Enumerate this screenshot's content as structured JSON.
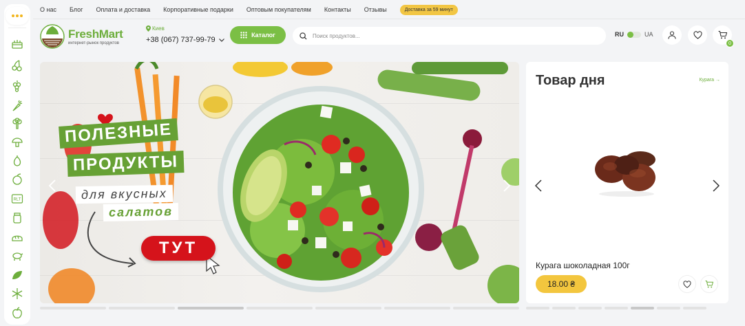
{
  "topnav": {
    "links": [
      "О нас",
      "Блог",
      "Оплата и доставка",
      "Корпоративные подарки",
      "Оптовым покупателям",
      "Контакты",
      "Отзывы"
    ],
    "delivery_badge": "Доставка за 59 минут"
  },
  "header": {
    "brand": "FreshMart",
    "brand_sub": "интернет-рынок продуктов",
    "city": "Киев",
    "phone": "+38 (067) 737-99-79",
    "catalog_label": "Каталог",
    "search_placeholder": "Поиск продуктов...",
    "lang_ru": "RU",
    "lang_ua": "UA",
    "cart_count": "0"
  },
  "sidebar": {
    "icons": [
      "menu-dots-icon",
      "cake-icon",
      "cherries-icon",
      "grapes-icon",
      "carrot-icon",
      "broccoli-icon",
      "mushroom-icon",
      "onion-icon",
      "peach-icon",
      "rlt-label-icon",
      "jar-icon",
      "bread-icon",
      "lamb-icon",
      "leaf-icon",
      "snowflake-icon",
      "apple-icon"
    ],
    "rlt_label": "RLT"
  },
  "banner": {
    "line1": "ПОЛЕЗНЫЕ",
    "line2": "ПРОДУКТЫ",
    "line3": "для вкусных",
    "line4": "салатов",
    "cta": "ТУТ"
  },
  "product_of_day": {
    "title": "Товар дня",
    "link": "Курага →",
    "name": "Курага шоколадная 100г",
    "price": "18.00 ₴"
  },
  "colors": {
    "accent_green": "#7bbf45",
    "accent_yellow": "#f3c63e",
    "cta_red": "#d5131b"
  }
}
